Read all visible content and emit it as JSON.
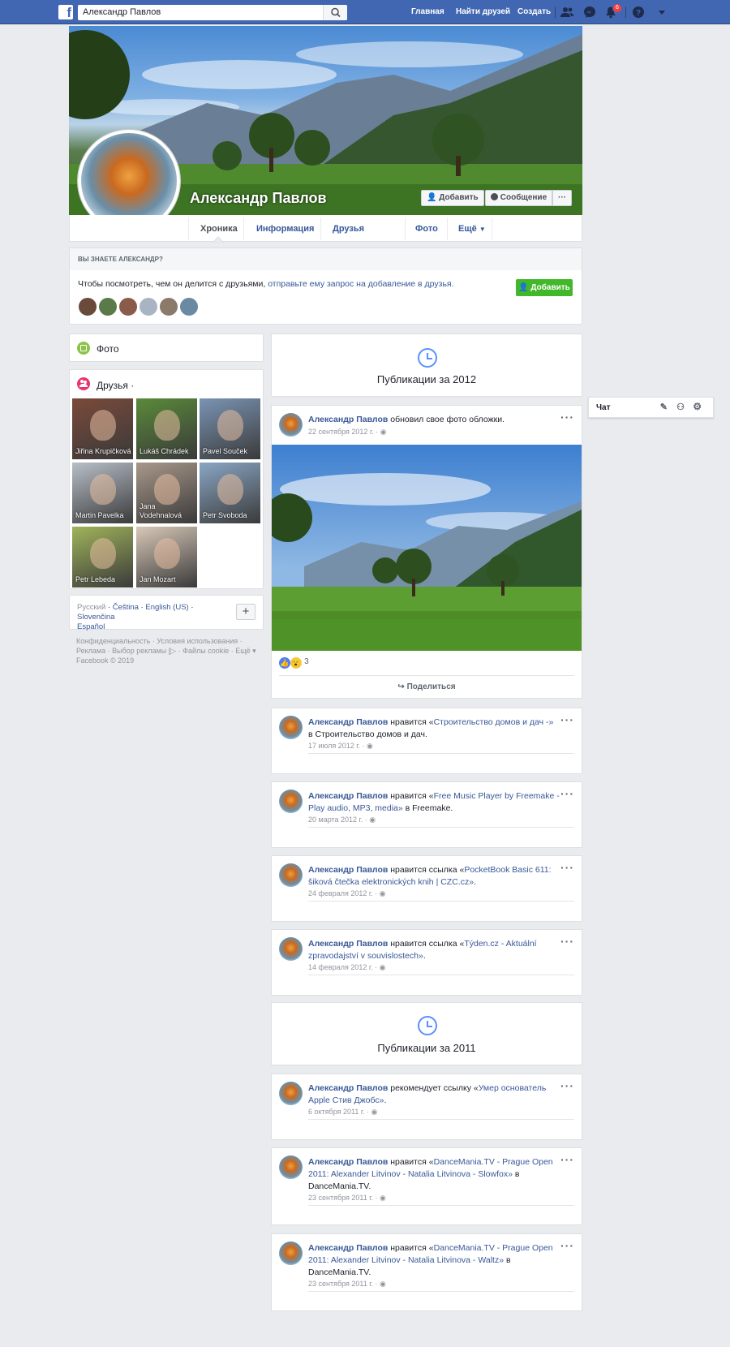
{
  "topbar": {
    "logo": "f",
    "search_value": "Александр Павлов",
    "nav": [
      "Главная",
      "Найти друзей",
      "Создать"
    ],
    "notification_count": "6"
  },
  "profile": {
    "name": "Александр Павлов",
    "add_btn": "Добавить",
    "message_btn": "Сообщение",
    "more_btn": "···",
    "tabs": [
      "Хроника",
      "Информация",
      "Друзья",
      "Фото",
      "Ещё"
    ]
  },
  "know": {
    "heading": "ВЫ ЗНАЕТЕ АЛЕКСАНДР?",
    "text_plain": "Чтобы посмотреть, чем он делится с друзьями, ",
    "text_link": "отправьте ему запрос на добавление в друзья.",
    "add_btn": "Добавить"
  },
  "sidebar": {
    "photos_title": "Фото",
    "friends_title": "Друзья ·",
    "friends": [
      {
        "name": "Jiřina Krupičková",
        "color": "#7a4a3a"
      },
      {
        "name": "Lukáš Chrádek",
        "color": "#5a8a3a"
      },
      {
        "name": "Pavel Souček",
        "color": "#7a94b4"
      },
      {
        "name": "Martin Pavelka",
        "color": "#b8bfc9"
      },
      {
        "name": "Jana Vodehnalová",
        "color": "#a8988a"
      },
      {
        "name": "Petr Svoboda",
        "color": "#8aa6c4"
      },
      {
        "name": "Petr Lebeda",
        "color": "#a0b45a"
      },
      {
        "name": "Jan Mozart",
        "color": "#d8c8b8"
      }
    ],
    "languages_1": "Русский",
    "lang_links": [
      "Čeština",
      "English (US)",
      "Slovenčina",
      "Español"
    ],
    "footer_line1": "Конфиденциальность · Условия использования ·",
    "footer_line2": "Реклама · Выбор рекламы [▷ · Файлы cookie · Ещё ▾",
    "copyright": "Facebook © 2019"
  },
  "feed": {
    "year_2012": "Публикации за 2012",
    "year_2011": "Публикации за 2011",
    "posts": [
      {
        "author": "Александр Павлов",
        "action": " обновил свое фото обложки.",
        "link": "",
        "tail": "",
        "date": "22 сентября 2012 г. ·"
      },
      {
        "author": "Александр Павлов",
        "action": " нравится «",
        "link": "Строительство домов и дач -»",
        "tail": " в Строительство домов и дач.",
        "date": "17 июля 2012 г. ·"
      },
      {
        "author": "Александр Павлов",
        "action": " нравится «",
        "link": "Free Music Player by Freemake - Play audio, MP3, media»",
        "tail": " в Freemake.",
        "date": "20 марта 2012 г. ·"
      },
      {
        "author": "Александр Павлов",
        "action": " нравится ссылка «",
        "link": "PocketBook Basic 611: šiková čtečka elektronických knih | CZC.cz»",
        "tail": ".",
        "date": "24 февраля 2012 г. ·"
      },
      {
        "author": "Александр Павлов",
        "action": " нравится ссылка «",
        "link": "Týden.cz - Aktuální zpravodajství v souvislostech»",
        "tail": ".",
        "date": "14 февраля 2012 г. ·"
      },
      {
        "author": "Александр Павлов",
        "action": " рекомендует ссылку «",
        "link": "Умер основатель Apple Стив Джобс»",
        "tail": ".",
        "date": "6 октября 2011 г. ·"
      },
      {
        "author": "Александр Павлов",
        "action": " нравится «",
        "link": "DanceMania.TV - Prague Open 2011: Alexander Litvinov - Natalia Litvinova - Slowfox»",
        "tail": " в DanceMania.TV.",
        "date": "23 сентября 2011 г. ·"
      },
      {
        "author": "Александр Павлов",
        "action": " нравится «",
        "link": "DanceMania.TV - Prague Open 2011: Alexander Litvinov - Natalia Litvinova - Waltz»",
        "tail": " в DanceMania.TV.",
        "date": "23 сентября 2011 г. ·"
      }
    ],
    "reactions_count": "3",
    "share_label": "Поделиться",
    "more_dots": "···"
  },
  "chat": {
    "label": "Чат"
  }
}
